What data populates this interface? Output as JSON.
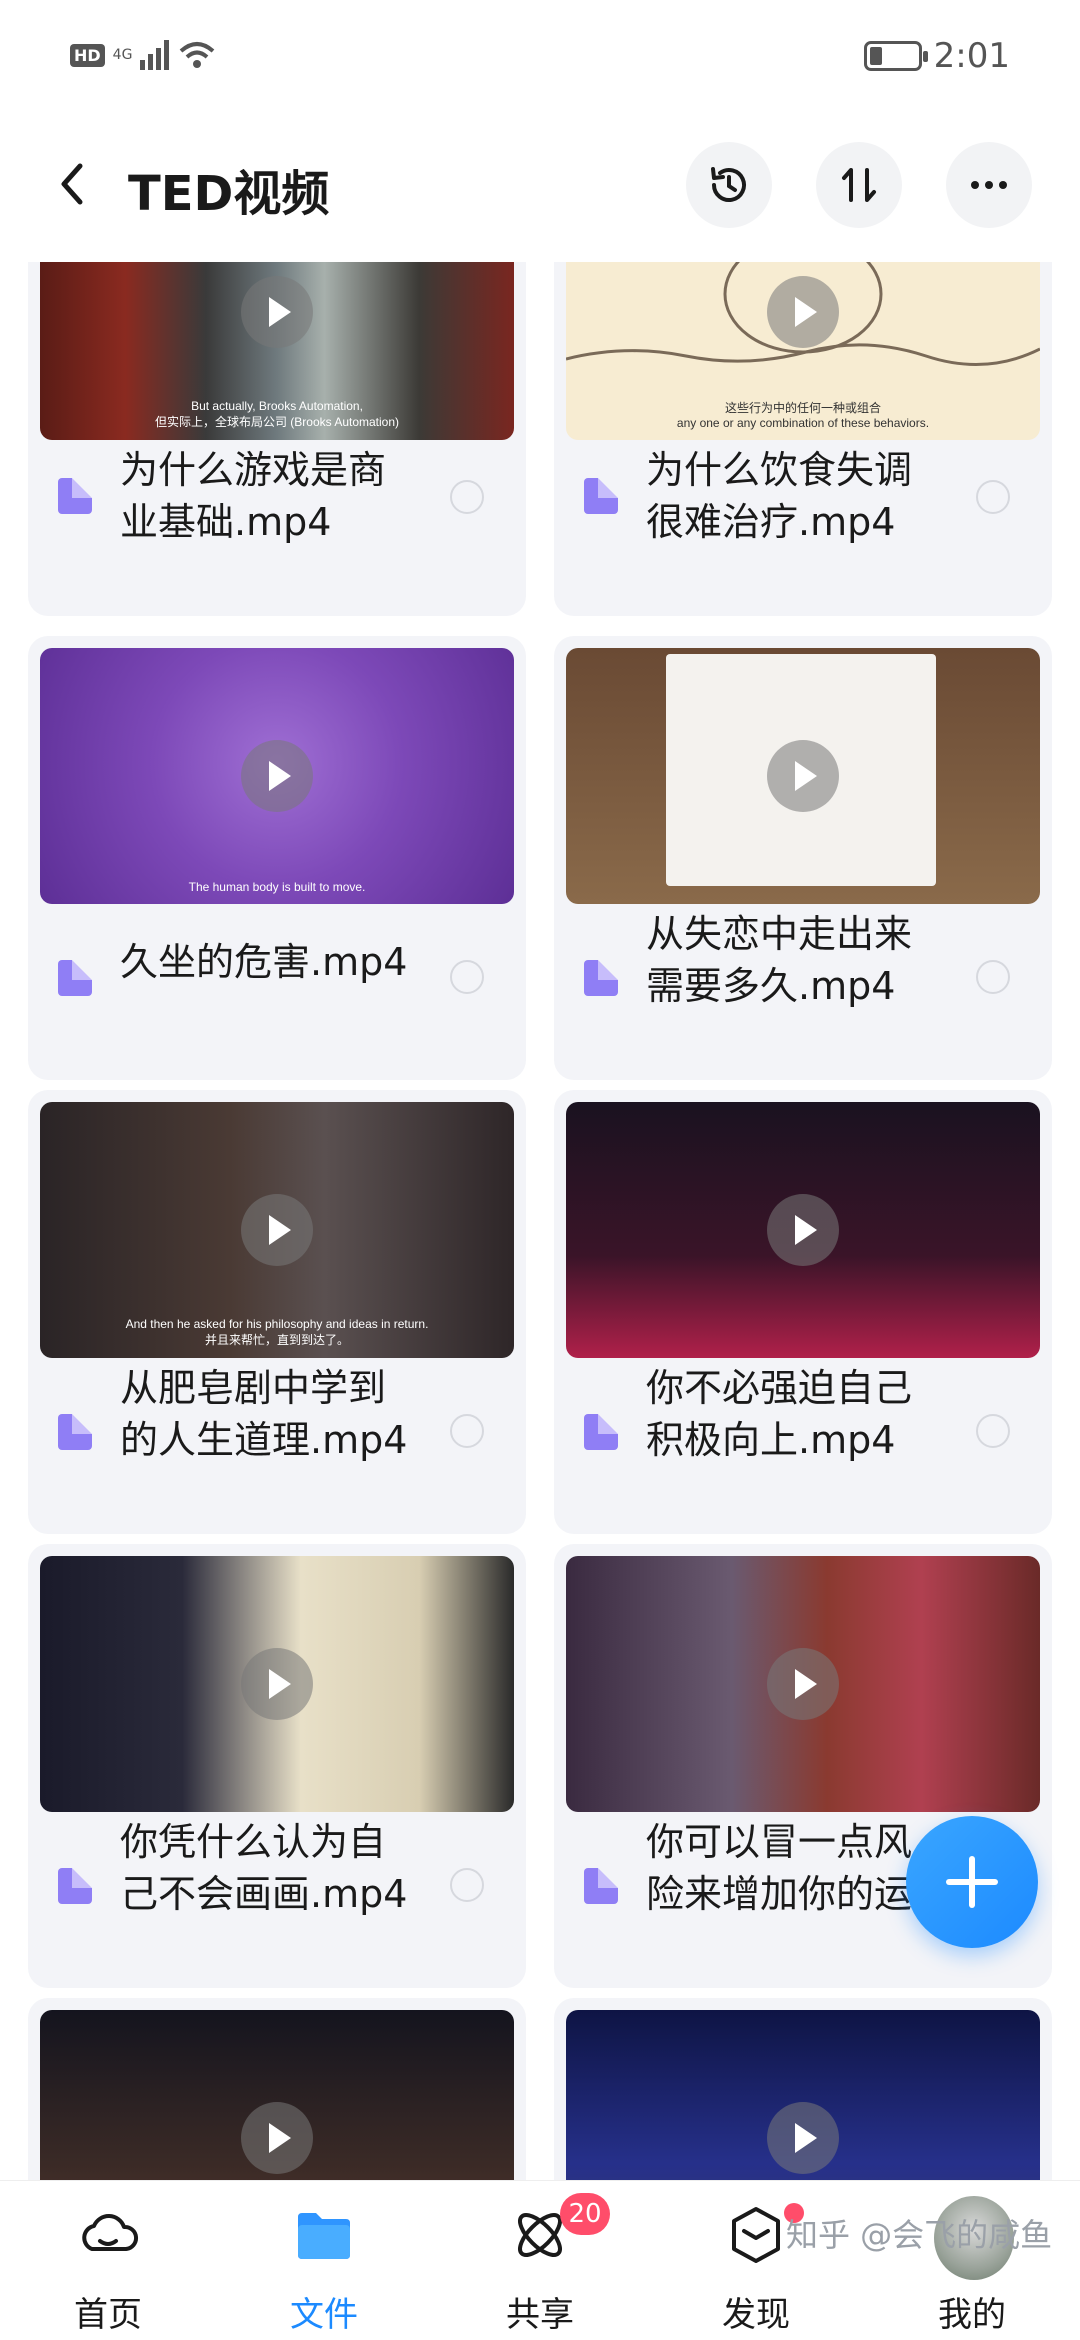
{
  "status_bar": {
    "hd": "HD",
    "network": "4G",
    "time": "2:01"
  },
  "header": {
    "title": "TED视频"
  },
  "files": [
    {
      "name": "为什么游戏是商\n业基础.mp4",
      "caption": "But actually, Brooks Automation,\n但实际上，全球布局公司 (Brooks Automation)"
    },
    {
      "name": "为什么饮食失调\n很难治疗.mp4",
      "caption": "这些行为中的任何一种或组合\nany one or any combination of these behaviors."
    },
    {
      "name": "久坐的危害.mp4",
      "caption": "The human body is built to move."
    },
    {
      "name": "从失恋中走出来\n需要多久.mp4",
      "caption": ""
    },
    {
      "name": "从肥皂剧中学到\n的人生道理.mp4",
      "caption": "And then he asked for his philosophy and ideas in return.\n并且来帮忙，直到到达了。"
    },
    {
      "name": "你不必强迫自己\n积极向上.mp4",
      "caption": ""
    },
    {
      "name": "你凭什么认为自\n己不会画画.mp4",
      "caption": ""
    },
    {
      "name": "你可以冒一点风\n险来增加你的运…",
      "caption": ""
    }
  ],
  "bottom_nav": [
    {
      "label": "首页",
      "icon": "home-cloud-icon"
    },
    {
      "label": "文件",
      "icon": "folder-icon"
    },
    {
      "label": "共享",
      "icon": "share-atom-icon",
      "badge": "20"
    },
    {
      "label": "发现",
      "icon": "discover-box-icon"
    },
    {
      "label": "我的",
      "icon": "profile-avatar"
    }
  ],
  "watermark": "知乎 @会飞的咸鱼",
  "colors": {
    "accent": "#1c8aff",
    "badge": "#ff4d6a",
    "file_icon": "#8f7ef5",
    "card_bg": "#f3f4f8"
  }
}
